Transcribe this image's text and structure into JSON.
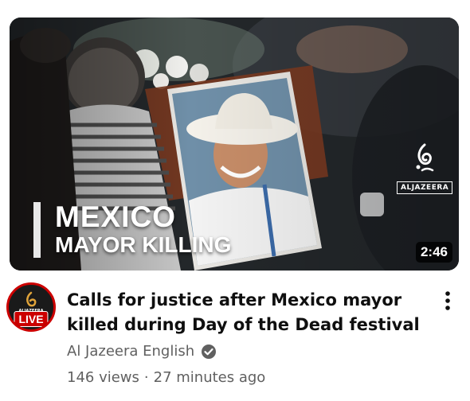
{
  "thumbnail": {
    "headline_line1": "MEXICO",
    "headline_line2": "MAYOR KILLING",
    "watermark_text": "ALJAZEERA",
    "duration": "2:46"
  },
  "channel_avatar": {
    "badge": "LIVE",
    "border_color": "#cc0000",
    "logo_text": "ALJAZEERA"
  },
  "video": {
    "title": "Calls for justice after Mexico mayor killed during Day of the Dead festival",
    "channel_name": "Al Jazeera English",
    "verified_icon": "verified-check-icon",
    "views": "146 views",
    "separator": "·",
    "age": "27 minutes ago"
  },
  "menu_icon": "more-vertical-icon",
  "colors": {
    "title": "#0f0f0f",
    "secondary_text": "#606060",
    "live_red": "#cc0000"
  }
}
